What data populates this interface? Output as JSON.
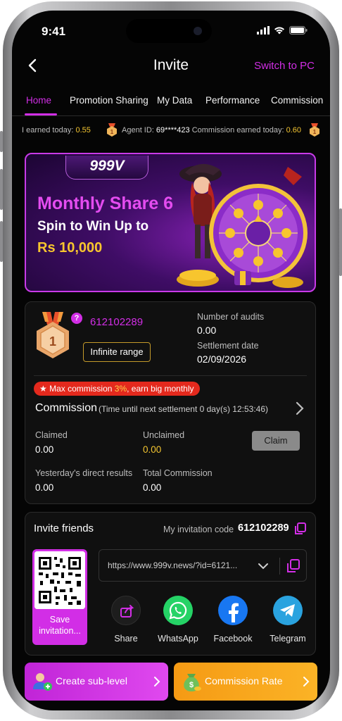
{
  "status_bar": {
    "time": "9:41"
  },
  "header": {
    "title": "Invite",
    "switch_label": "Switch to PC"
  },
  "tabs": [
    {
      "label": "Home",
      "active": true
    },
    {
      "label": "Promotion Sharing",
      "active": false
    },
    {
      "label": "My Data",
      "active": false
    },
    {
      "label": "Performance",
      "active": false
    },
    {
      "label": "Commission",
      "active": false
    }
  ],
  "ticker": {
    "earned_label": "I earned today:",
    "earned_value": "0.55",
    "agent_label": "Agent ID:",
    "agent_value": "69****423",
    "commission_label": "Commission earned today:",
    "commission_value": "0.60"
  },
  "banner": {
    "logo": "999V",
    "title": "Monthly Share 6",
    "subtitle": "Spin to Win Up to",
    "prize": "Rs 10,000"
  },
  "agent_card": {
    "rank": "1",
    "help_glyph": "?",
    "agent_id": "612102289",
    "range_label": "Infinite range",
    "audits_label": "Number of audits",
    "audits_value": "0.00",
    "settlement_label": "Settlement date",
    "settlement_value": "02/09/2026",
    "badge_prefix": "★ Max commission ",
    "badge_highlight": "3%",
    "badge_suffix": ", earn big monthly",
    "commission_title": "Commission",
    "commission_timer": "(Time until next settlement   0 day(s) 12:53:46)",
    "claimed_label": "Claimed",
    "claimed_value": "0.00",
    "unclaimed_label": "Unclaimed",
    "unclaimed_value": "0.00",
    "claim_button": "Claim",
    "yesterday_label": "Yesterday's direct results",
    "yesterday_value": "0.00",
    "total_label": "Total Commission",
    "total_value": "0.00"
  },
  "invite_card": {
    "title": "Invite friends",
    "code_label": "My invitation code",
    "code_value": "612102289",
    "qr_label": "Save invitation...",
    "link": "https://www.999v.news/?id=6121...",
    "share_options": [
      {
        "label": "Share",
        "icon": "share-icon"
      },
      {
        "label": "WhatsApp",
        "icon": "whatsapp-icon"
      },
      {
        "label": "Facebook",
        "icon": "facebook-icon"
      },
      {
        "label": "Telegram",
        "icon": "telegram-icon"
      }
    ]
  },
  "bottom_buttons": {
    "create_label": "Create sub-level",
    "rate_label": "Commission Rate"
  },
  "colors": {
    "accent": "#d22ee6",
    "gold": "#f3c531",
    "orange": "#f59a14",
    "background": "#050505"
  }
}
